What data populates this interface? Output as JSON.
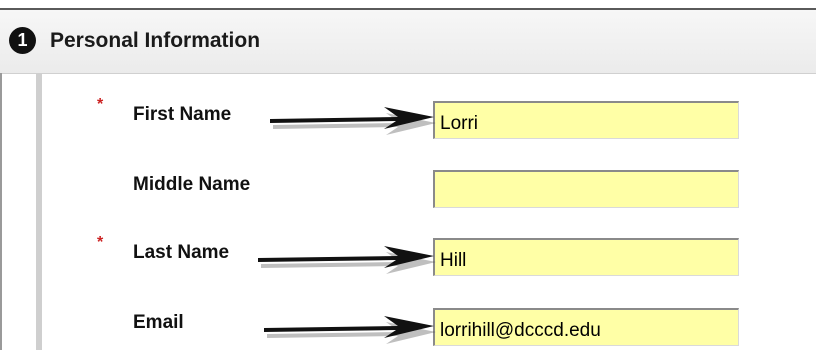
{
  "section": {
    "step_number": "1",
    "title": "Personal Information"
  },
  "fields": {
    "first_name": {
      "label": "First Name",
      "required_marker": "*",
      "value": "Lorri"
    },
    "middle_name": {
      "label": "Middle Name",
      "value": ""
    },
    "last_name": {
      "label": "Last Name",
      "required_marker": "*",
      "value": "Hill"
    },
    "email": {
      "label": "Email",
      "value": "lorrihill@dcccd.edu"
    }
  },
  "colors": {
    "field_background": "#ffffa6",
    "required_marker": "#cc2222",
    "arrow": "#111111"
  },
  "icons": [
    "step-number-circle",
    "arrow-right-icon"
  ]
}
